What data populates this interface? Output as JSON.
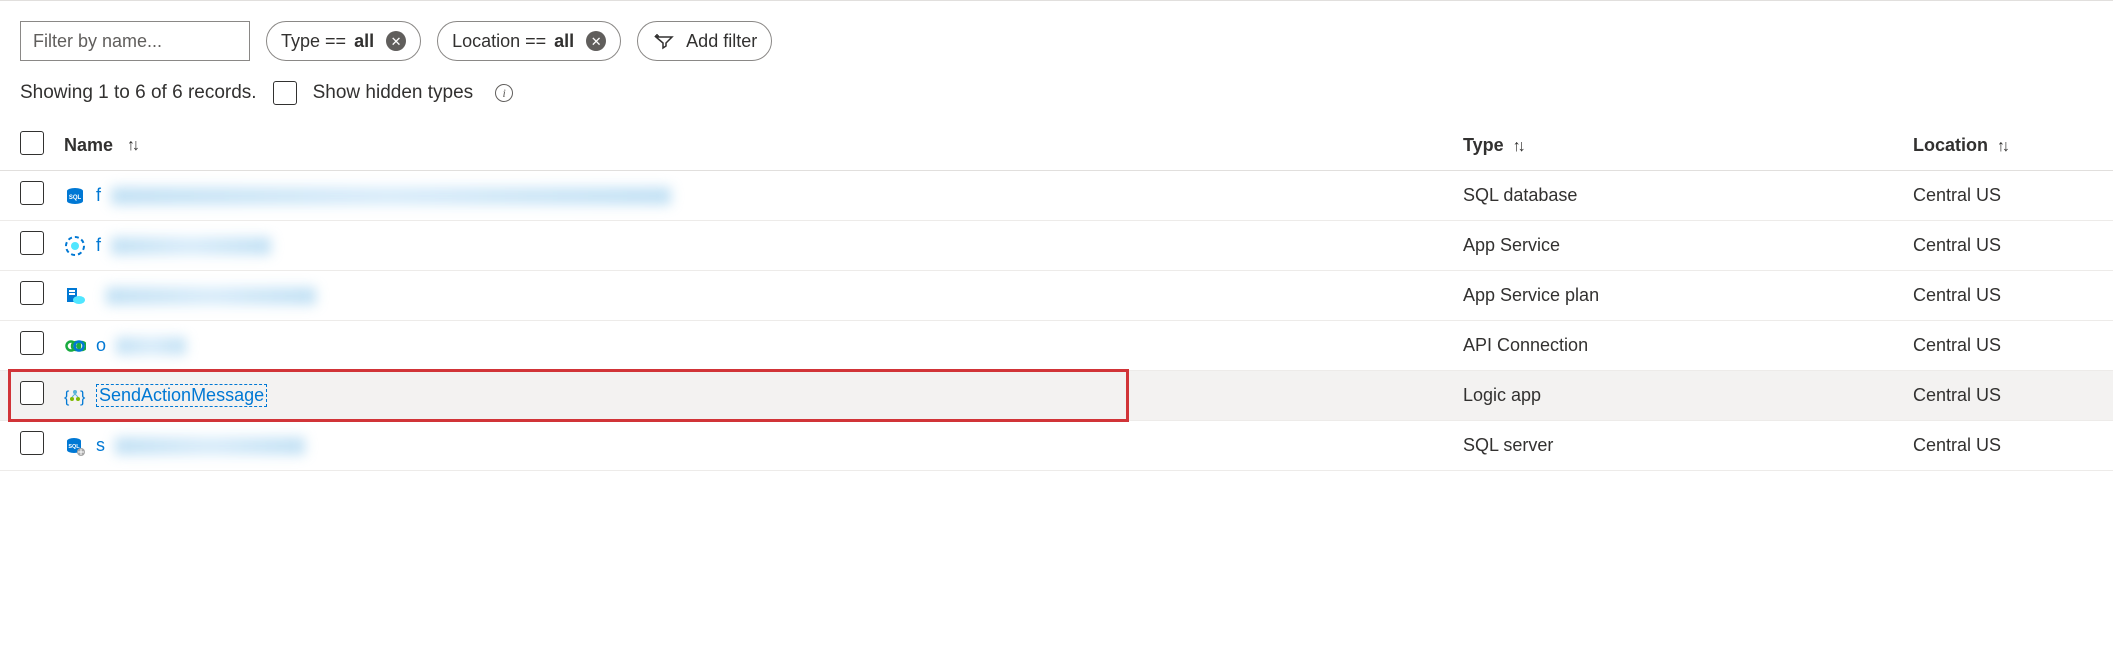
{
  "filters": {
    "name_placeholder": "Filter by name...",
    "type_label": "Type == ",
    "type_value": "all",
    "location_label": "Location == ",
    "location_value": "all",
    "add_filter": "Add filter"
  },
  "records": {
    "showing": "Showing 1 to 6 of 6 records.",
    "show_hidden": "Show hidden types"
  },
  "columns": {
    "name": "Name",
    "type": "Type",
    "location": "Location"
  },
  "rows": [
    {
      "id": 0,
      "name_visible": "f",
      "redacted_width": 560,
      "type": "SQL database",
      "location": "Central US",
      "icon": "sql-db",
      "highlighted": false,
      "boxed": false
    },
    {
      "id": 1,
      "name_visible": "f",
      "redacted_width": 160,
      "type": "App Service",
      "location": "Central US",
      "icon": "app-service",
      "highlighted": false,
      "boxed": false
    },
    {
      "id": 2,
      "name_visible": "",
      "redacted_width": 210,
      "type": "App Service plan",
      "location": "Central US",
      "icon": "app-plan",
      "highlighted": false,
      "boxed": false
    },
    {
      "id": 3,
      "name_visible": "o",
      "redacted_width": 70,
      "type": "API Connection",
      "location": "Central US",
      "icon": "api-conn",
      "highlighted": false,
      "boxed": false
    },
    {
      "id": 4,
      "name_visible": "SendActionMessage",
      "redacted_width": 0,
      "type": "Logic app",
      "location": "Central US",
      "icon": "logic-app",
      "highlighted": true,
      "boxed": true
    },
    {
      "id": 5,
      "name_visible": "s",
      "redacted_width": 190,
      "type": "SQL server",
      "location": "Central US",
      "icon": "sql-server",
      "highlighted": false,
      "boxed": false
    }
  ]
}
